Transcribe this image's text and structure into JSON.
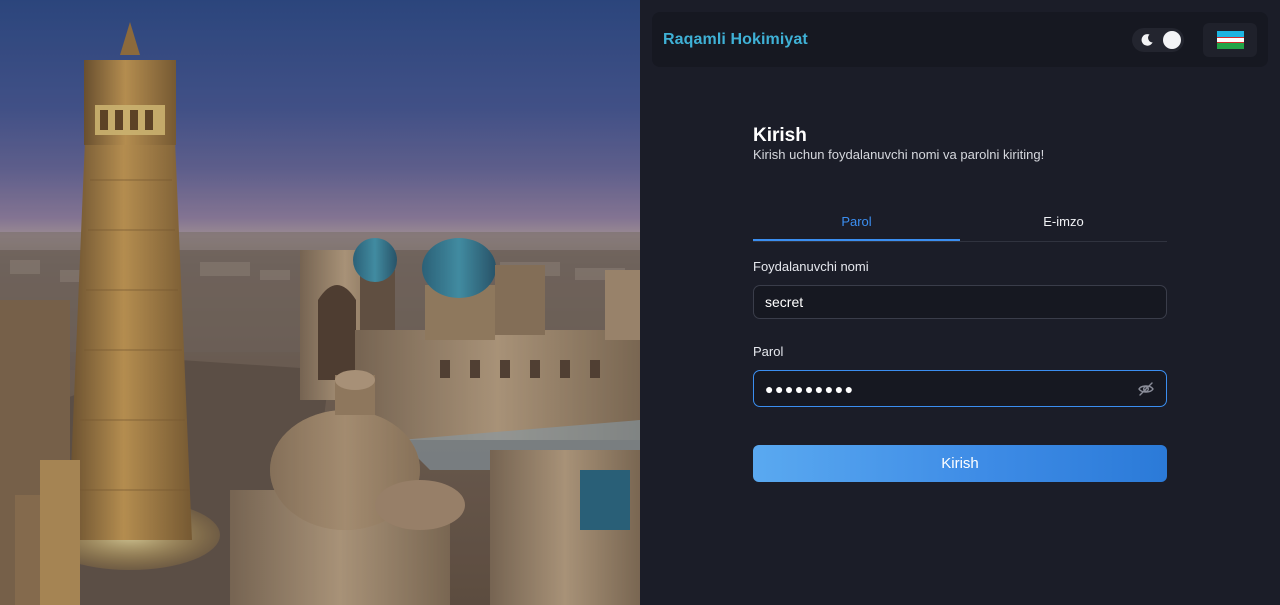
{
  "header": {
    "brand": "Raqamli Hokimiyat",
    "theme_toggle_icon": "moon-icon",
    "language_flag_icon": "uzbekistan-flag-icon"
  },
  "login": {
    "title": "Kirish",
    "subtitle": "Kirish uchun foydalanuvchi nomi va parolni kiriting!",
    "tabs": [
      {
        "label": "Parol",
        "active": true
      },
      {
        "label": "E-imzo",
        "active": false
      }
    ],
    "username_label": "Foydalanuvchi nomi",
    "username_value": "secret",
    "password_label": "Parol",
    "password_masked": "●●●●●●●●●",
    "password_visibility_icon": "eye-off-icon",
    "submit_label": "Kirish"
  },
  "colors": {
    "brand": "#3fb1d6",
    "accent": "#3b8ef0",
    "panel_bg": "#1b1d28"
  }
}
